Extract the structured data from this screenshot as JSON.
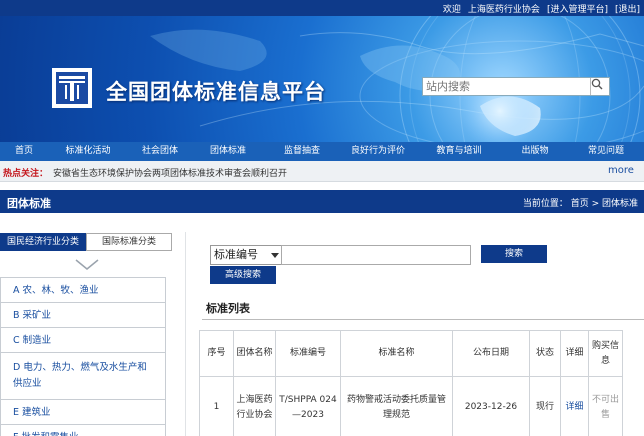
{
  "topbar": {
    "welcome": "欢迎",
    "org": "上海医药行业协会",
    "admin": "[进入管理平台]",
    "logout": "[退出]"
  },
  "banner": {
    "site_title": "全国团体标准信息平台",
    "search_placeholder": "站内搜索"
  },
  "nav": [
    "首页",
    "标准化活动",
    "社会团体",
    "团体标准",
    "监督抽查",
    "良好行为评价",
    "教育与培训",
    "出版物",
    "常见问题"
  ],
  "hot": {
    "label": "热点关注：",
    "text": "安徽省生态环境保护协会两项团体标准技术审查会顺利召开",
    "more": "more"
  },
  "section": {
    "title": "团体标准",
    "breadcrumb": "当前位置：  首页 > 团体标准"
  },
  "tabs": {
    "active": "国民经济行业分类",
    "inactive": "国际标准分类"
  },
  "categories": [
    "A 农、林、牧、渔业",
    "B 采矿业",
    "C 制造业",
    "D 电力、热力、燃气及水生产和供应业",
    "E 建筑业",
    "F 批发和零售业"
  ],
  "search": {
    "select_value": "标准编号",
    "search_button": "搜索",
    "advanced_button": "高级搜索"
  },
  "list": {
    "title": "标准列表",
    "headers": [
      "序号",
      "团体名称",
      "标准编号",
      "标准名称",
      "公布日期",
      "状态",
      "详细",
      "购买信息"
    ],
    "rows": [
      {
        "no": "1",
        "org": "上海医药行业协会",
        "code": "T/SHPPA 024—2023",
        "name": "药物警戒活动委托质量管理规范",
        "date": "2023-12-26",
        "status": "现行",
        "detail": "详细",
        "buy": "不可出售"
      }
    ]
  },
  "colors": {
    "dark_blue": "#0e3a8a",
    "nav_blue": "#1a61b8",
    "link_blue": "#1a4fa0",
    "hot_red": "#c4161c"
  }
}
